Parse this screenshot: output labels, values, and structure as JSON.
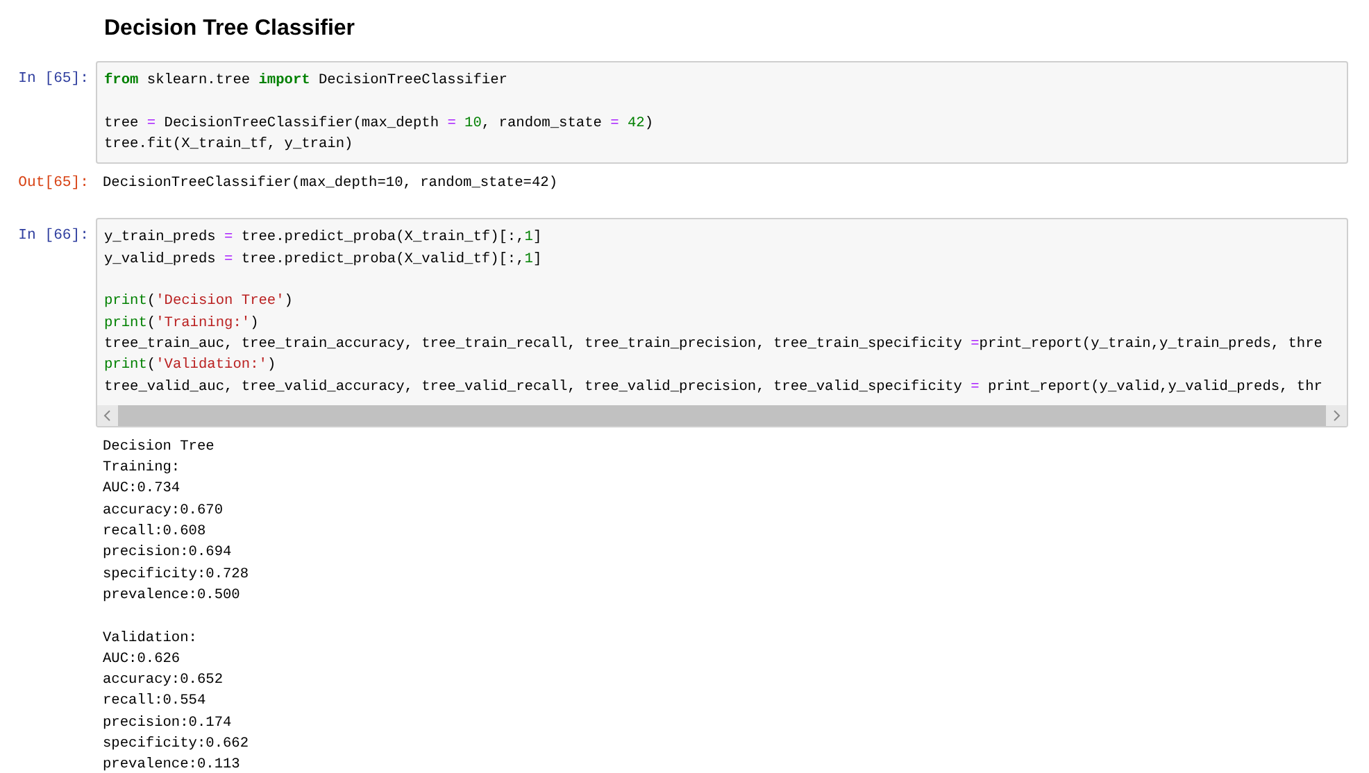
{
  "heading": "Decision Tree Classifier",
  "cells": [
    {
      "kind": "code",
      "prompt": "In [65]:",
      "blocks": [
        [
          [
            {
              "kind": "kw",
              "text": "from"
            },
            {
              "kind": "plain",
              "text": " sklearn.tree "
            },
            {
              "kind": "kw",
              "text": "import"
            },
            {
              "kind": "plain",
              "text": " DecisionTreeClassifier"
            }
          ]
        ],
        [
          [
            {
              "kind": "plain",
              "text": "tree "
            },
            {
              "kind": "op",
              "text": "="
            },
            {
              "kind": "plain",
              "text": " DecisionTreeClassifier(max_depth "
            },
            {
              "kind": "op",
              "text": "="
            },
            {
              "kind": "num",
              "text": " 10"
            },
            {
              "kind": "plain",
              "text": ", random_state "
            },
            {
              "kind": "op",
              "text": "="
            },
            {
              "kind": "num",
              "text": " 42"
            },
            {
              "kind": "plain",
              "text": ")"
            }
          ],
          [
            {
              "kind": "plain",
              "text": "tree.fit(X_train_tf, y_train)"
            }
          ]
        ]
      ]
    },
    {
      "kind": "output",
      "prompt": "Out[65]:",
      "blocks": [
        [
          "DecisionTreeClassifier(max_depth=10, random_state=42)"
        ]
      ]
    },
    {
      "kind": "code",
      "prompt": "In [66]:",
      "scrollbar": true,
      "blocks": [
        [
          [
            {
              "kind": "plain",
              "text": "y_train_preds "
            },
            {
              "kind": "op",
              "text": "="
            },
            {
              "kind": "plain",
              "text": " tree.predict_proba(X_train_tf)[:,"
            },
            {
              "kind": "num",
              "text": "1"
            },
            {
              "kind": "plain",
              "text": "]"
            }
          ],
          [
            {
              "kind": "plain",
              "text": "y_valid_preds "
            },
            {
              "kind": "op",
              "text": "="
            },
            {
              "kind": "plain",
              "text": " tree.predict_proba(X_valid_tf)[:,"
            },
            {
              "kind": "num",
              "text": "1"
            },
            {
              "kind": "plain",
              "text": "]"
            }
          ]
        ],
        [
          [
            {
              "kind": "builtin",
              "text": "print"
            },
            {
              "kind": "plain",
              "text": "("
            },
            {
              "kind": "str",
              "text": "'Decision Tree'"
            },
            {
              "kind": "plain",
              "text": ")"
            }
          ],
          [
            {
              "kind": "builtin",
              "text": "print"
            },
            {
              "kind": "plain",
              "text": "("
            },
            {
              "kind": "str",
              "text": "'Training:'"
            },
            {
              "kind": "plain",
              "text": ")"
            }
          ],
          [
            {
              "kind": "plain",
              "text": "tree_train_auc, tree_train_accuracy, tree_train_recall, tree_train_precision, tree_train_specificity "
            },
            {
              "kind": "op",
              "text": "="
            },
            {
              "kind": "plain",
              "text": "print_report(y_train,y_train_preds, thre"
            }
          ],
          [
            {
              "kind": "builtin",
              "text": "print"
            },
            {
              "kind": "plain",
              "text": "("
            },
            {
              "kind": "str",
              "text": "'Validation:'"
            },
            {
              "kind": "plain",
              "text": ")"
            }
          ],
          [
            {
              "kind": "plain",
              "text": "tree_valid_auc, tree_valid_accuracy, tree_valid_recall, tree_valid_precision, tree_valid_specificity "
            },
            {
              "kind": "op",
              "text": "="
            },
            {
              "kind": "plain",
              "text": " print_report(y_valid,y_valid_preds, thr"
            }
          ]
        ]
      ]
    },
    {
      "kind": "output",
      "blocks": [
        [
          "Decision Tree",
          "Training:",
          "AUC:0.734",
          "accuracy:0.670",
          "recall:0.608",
          "precision:0.694",
          "specificity:0.728",
          "prevalence:0.500"
        ],
        [
          "Validation:",
          "AUC:0.626",
          "accuracy:0.652",
          "recall:0.554",
          "precision:0.174",
          "specificity:0.662",
          "prevalence:0.113"
        ]
      ]
    }
  ]
}
